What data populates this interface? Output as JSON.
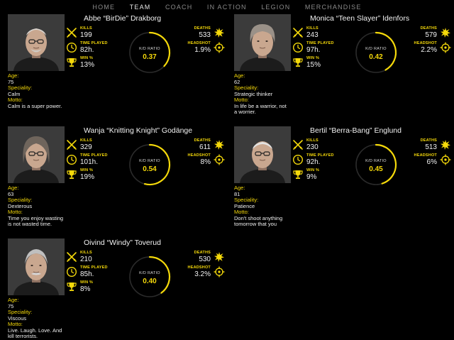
{
  "nav": {
    "items": [
      "HOME",
      "TEAM",
      "COACH",
      "IN ACTION",
      "LEGION",
      "MERCHANDISE"
    ],
    "active": "TEAM"
  },
  "labels": {
    "kills": "KILLS",
    "time": "TIME PLAYED",
    "win": "WIN %",
    "deaths": "DEATHS",
    "headshot": "HEADSHOT",
    "kd": "K/D RATIO",
    "age": "Age:",
    "speciality": "Speciality:",
    "motto": "Motto:"
  },
  "colors": {
    "accent": "#f5d90a",
    "background": "#000000",
    "track": "#2b2b2b"
  },
  "players": [
    {
      "name": "Abbe “BirDie” Drakborg",
      "kills": "199",
      "time_played": "82h.",
      "win_pct": "13%",
      "deaths": "533",
      "headshot": "1.9%",
      "kd_ratio": "0.37",
      "kd_value": 0.37,
      "age": "75",
      "speciality": "Calm",
      "motto": "Calm is a super power.",
      "photo_icon": "portrait-bald-man"
    },
    {
      "name": "Monica “Teen Slayer” Idenfors",
      "kills": "243",
      "time_played": "97h.",
      "win_pct": "15%",
      "deaths": "579",
      "headshot": "2.2%",
      "kd_ratio": "0.42",
      "kd_value": 0.42,
      "age": "62",
      "speciality": "Strategic thinker",
      "motto": "In life be a warrior, not a worrier.",
      "photo_icon": "portrait-woman-short-hair"
    },
    {
      "name": "Wanja “Knitting Knight” Godänge",
      "kills": "329",
      "time_played": "101h.",
      "win_pct": "19%",
      "deaths": "611",
      "headshot": "8%",
      "kd_ratio": "0.54",
      "kd_value": 0.54,
      "age": "63",
      "speciality": "Dexterous",
      "motto": "Time you enjoy wasting is not wasted time.",
      "photo_icon": "portrait-woman-glasses"
    },
    {
      "name": "Bertil “Berra-Bang” Englund",
      "kills": "230",
      "time_played": "92h.",
      "win_pct": "9%",
      "deaths": "513",
      "headshot": "6%",
      "kd_ratio": "0.45",
      "kd_value": 0.45,
      "age": "81",
      "speciality": "Patience",
      "motto": "Don't shoot anything tomorrow that you",
      "photo_icon": "portrait-man-glasses"
    },
    {
      "name": "Oivind “Windy” Toverud",
      "kills": "210",
      "time_played": "85h.",
      "win_pct": "8%",
      "deaths": "530",
      "headshot": "3.2%",
      "kd_ratio": "0.40",
      "kd_value": 0.4,
      "age": "75",
      "speciality": "Viscous",
      "motto": "Live. Laugh. Love. And kill terrorists.",
      "photo_icon": "portrait-man-mustache"
    }
  ]
}
